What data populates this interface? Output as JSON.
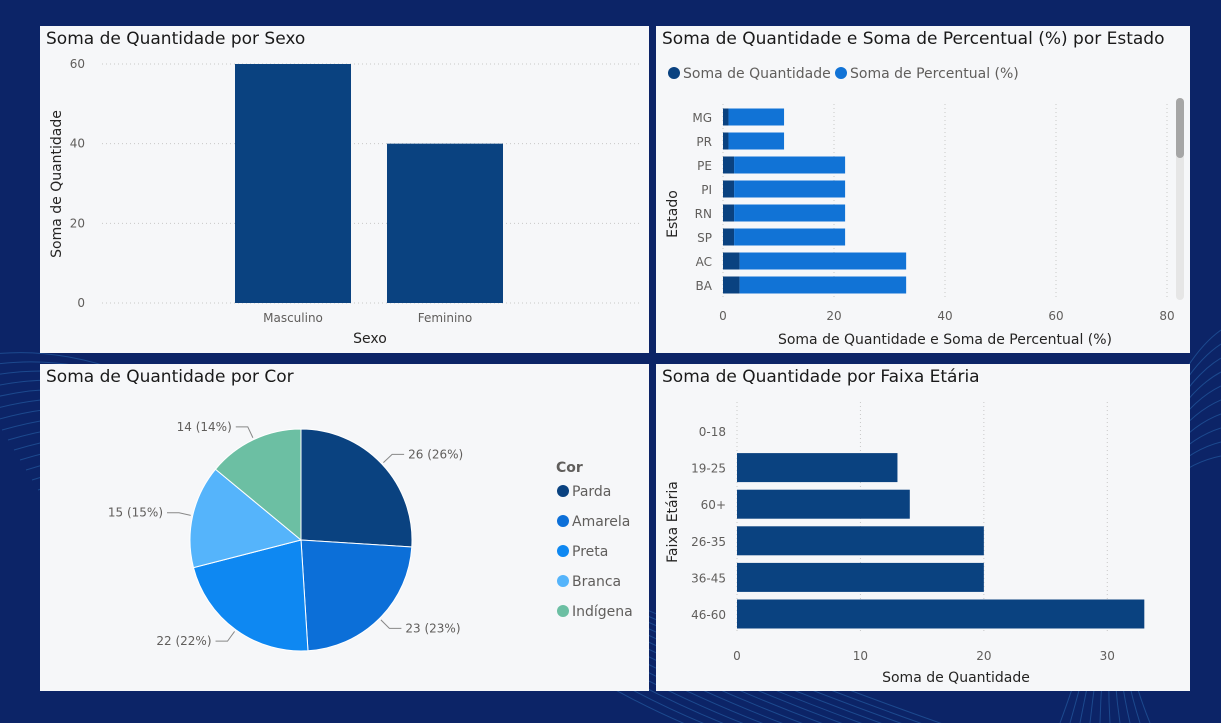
{
  "colors": {
    "background": "#0c2467",
    "panel": "#f6f7f9",
    "dark_blue": "#0a4280",
    "mid_blue": "#1173d6",
    "blue_2": "#0c6fd8",
    "blue_3": "#0e88f2",
    "light_blue": "#55b4fb",
    "teal": "#6cbfa3"
  },
  "panels": {
    "sexo": {
      "title": "Soma de Quantidade por Sexo"
    },
    "estado": {
      "title": "Soma de Quantidade e Soma de Percentual (%) por Estado"
    },
    "cor": {
      "title": "Soma de Quantidade por Cor"
    },
    "faixa": {
      "title": "Soma de Quantidade por Faixa Etária"
    }
  },
  "chart_data": [
    {
      "type": "bar",
      "title": "Soma de Quantidade por Sexo",
      "categories": [
        "Masculino",
        "Feminino"
      ],
      "values": [
        60,
        40
      ],
      "xlabel": "Sexo",
      "ylabel": "Soma de Quantidade",
      "ylim": [
        0,
        60
      ],
      "yticks": [
        "0",
        "20",
        "40",
        "60"
      ],
      "grid": true
    },
    {
      "type": "bar",
      "orientation": "horizontal",
      "stacked": true,
      "title": "Soma de Quantidade e Soma de Percentual (%) por Estado",
      "categories": [
        "MG",
        "PR",
        "PE",
        "PI",
        "RN",
        "SP",
        "AC",
        "BA"
      ],
      "series": [
        {
          "name": "Soma de Quantidade",
          "values": [
            1,
            1,
            2,
            2,
            2,
            2,
            3,
            3
          ]
        },
        {
          "name": "Soma de Percentual (%)",
          "values": [
            10,
            10,
            20,
            20,
            20,
            20,
            30,
            30
          ]
        }
      ],
      "xlabel": "Soma de Quantidade e Soma de Percentual (%)",
      "ylabel": "Estado",
      "xlim": [
        0,
        80
      ],
      "xticks": [
        "0",
        "20",
        "40",
        "60",
        "80"
      ],
      "legend": "top-left",
      "grid": true
    },
    {
      "type": "pie",
      "title": "Soma de Quantidade por Cor",
      "legend_title": "Cor",
      "categories": [
        "Parda",
        "Amarela",
        "Preta",
        "Branca",
        "Indígena"
      ],
      "values": [
        26,
        23,
        22,
        15,
        14
      ],
      "labels": [
        "26 (26%)",
        "23 (23%)",
        "22 (22%)",
        "15 (15%)",
        "14 (14%)"
      ],
      "legend": "right"
    },
    {
      "type": "bar",
      "orientation": "horizontal",
      "title": "Soma de Quantidade por Faixa Etária",
      "categories": [
        "0-18",
        "19-25",
        "60+",
        "26-35",
        "36-45",
        "46-60"
      ],
      "values": [
        0,
        13,
        14,
        20,
        20,
        33
      ],
      "xlabel": "Soma de Quantidade",
      "ylabel": "Faixa Etária",
      "xlim": [
        0,
        35
      ],
      "xticks": [
        "0",
        "10",
        "20",
        "30"
      ],
      "grid": true
    }
  ]
}
